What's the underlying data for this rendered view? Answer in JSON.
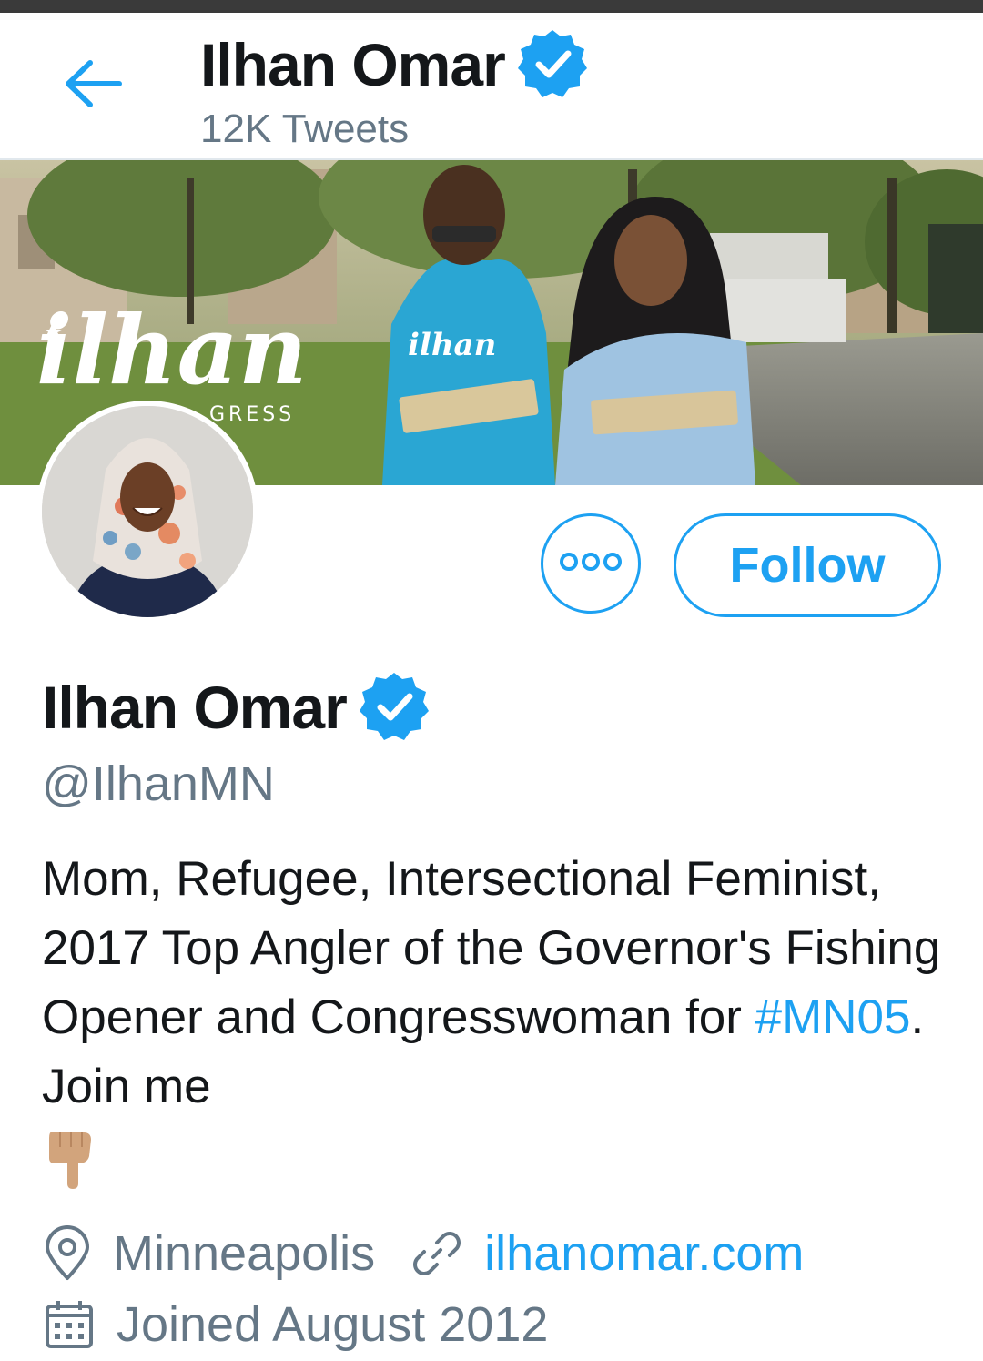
{
  "header": {
    "title": "Ilhan Omar",
    "subtitle": "12K Tweets",
    "back_icon": "arrow-left-icon",
    "verified_icon": "verified-badge-icon"
  },
  "banner": {
    "brand_text": "ilhan",
    "brand_sub": "GRESS",
    "shirt_text": "ilhan"
  },
  "actions": {
    "more_icon": "more-options-icon",
    "follow_label": "Follow"
  },
  "profile": {
    "name": "Ilhan Omar",
    "handle": "@IlhanMN",
    "bio_text": "Mom, Refugee, Intersectional Feminist, 2017 Top Angler of the Governor's Fishing Opener and Congresswoman for ",
    "bio_hashtag": "#MN05",
    "bio_tail": ". Join me",
    "bio_emoji": "pointing-down-emoji",
    "location": "Minneapolis",
    "website": "ilhanomar.com",
    "joined": "Joined August 2012"
  },
  "colors": {
    "accent": "#1da1f2",
    "text_primary": "#14171a",
    "text_secondary": "#657786",
    "border": "#e1e8ed"
  }
}
